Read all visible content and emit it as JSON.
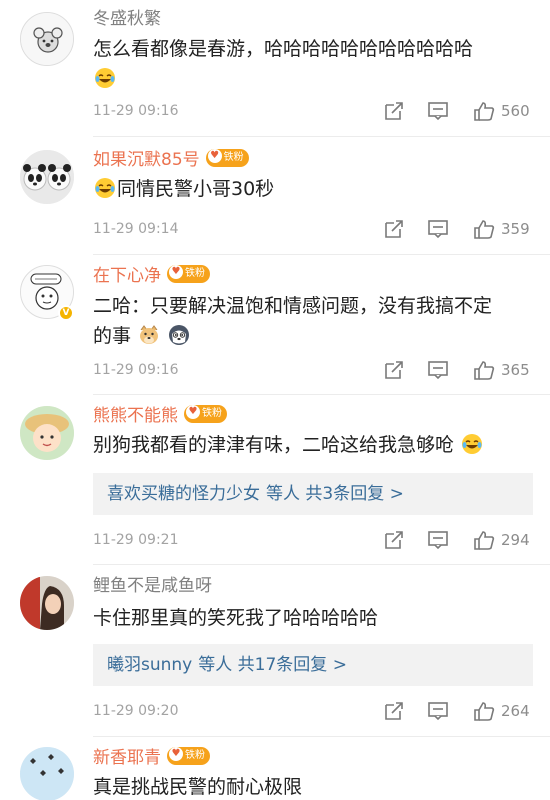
{
  "comments": [
    {
      "username": "冬盛秋繁",
      "text": "怎么看都像是春游，哈哈哈哈哈哈哈哈哈哈哈",
      "time": "11-29 09:16",
      "likes": "560",
      "emoji": [
        "laughing-tears"
      ]
    },
    {
      "username": "如果沉默85号",
      "badge": "铁粉",
      "text": "同情民警小哥30秒",
      "time": "11-29 09:14",
      "likes": "359",
      "emoji": [
        "laughing-tears"
      ]
    },
    {
      "username": "在下心净",
      "badge": "铁粉",
      "text_line1": "二哈：只要解决温饱和情感问题，没有我搞不定",
      "text_line2": "的事",
      "time": "11-29 09:16",
      "likes": "365",
      "emoji": [
        "doge",
        "husky"
      ]
    },
    {
      "username": "熊熊不能熊",
      "badge": "铁粉",
      "text": "别狗我都看的津津有味，二哈这给我急够呛",
      "reply_names": "喜欢买糖的怪力少女",
      "reply_rest": "等人 共3条回复 >",
      "time": "11-29 09:21",
      "likes": "294",
      "emoji": [
        "laughing-tears"
      ]
    },
    {
      "username": "鲤鱼不是咸鱼呀",
      "text": "卡住那里真的笑死我了哈哈哈哈哈",
      "reply_names": "曦羽sunny",
      "reply_rest": "等人 共17条回复 >",
      "time": "11-29 09:20",
      "likes": "264"
    },
    {
      "username": "新香耶青",
      "badge": "铁粉",
      "text": "真是挑战民警的耐心极限"
    }
  ],
  "icons": {
    "share": "share-icon",
    "reply": "comment-icon",
    "like": "thumbs-up-icon"
  },
  "colors": {
    "username_member": "#eb7350",
    "username_regular": "#808080",
    "reply_link": "#3a6d99",
    "badge": "#f6a21b"
  }
}
